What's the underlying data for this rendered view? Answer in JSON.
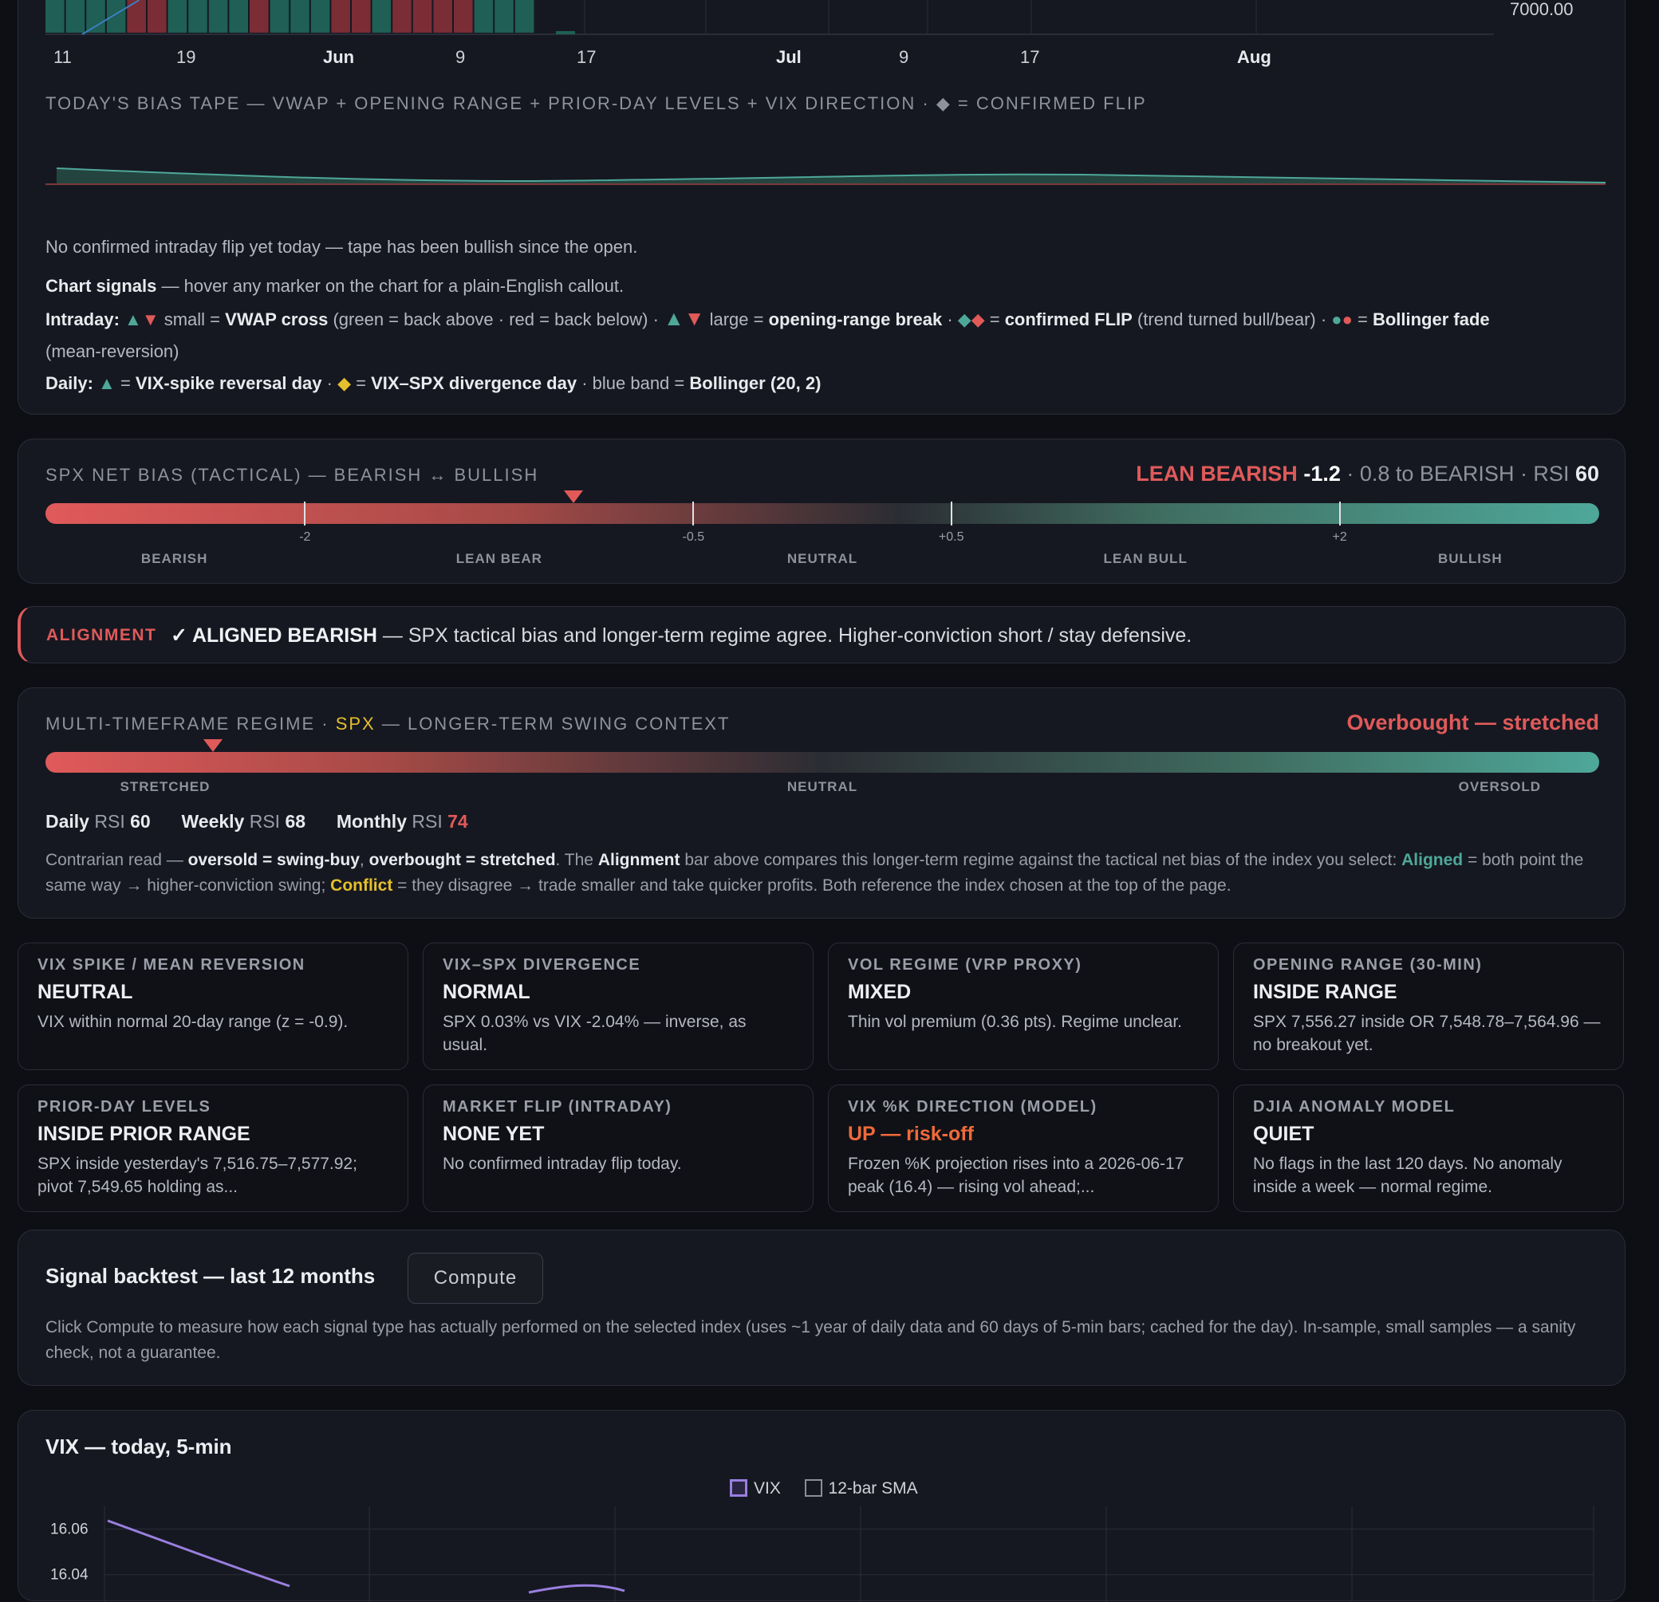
{
  "top_chart": {
    "x_ticks": [
      {
        "label": "11",
        "bold": false
      },
      {
        "label": "19",
        "bold": false
      },
      {
        "label": "Jun",
        "bold": true
      },
      {
        "label": "9",
        "bold": false
      },
      {
        "label": "17",
        "bold": false
      },
      {
        "label": "Jul",
        "bold": true
      },
      {
        "label": "9",
        "bold": false
      },
      {
        "label": "17",
        "bold": false
      },
      {
        "label": "Aug",
        "bold": true
      }
    ],
    "y_label": "7000.00",
    "bar_colors": [
      "#1f5f55",
      "#1f5f55",
      "#1f5f55",
      "#1f5f55",
      "#7a2d35",
      "#7a2d35",
      "#1f5f55",
      "#1f5f55",
      "#1f5f55",
      "#1f5f55",
      "#7a2d35",
      "#1f5f55",
      "#1f5f55",
      "#1f5f55",
      "#7a2d35",
      "#7a2d35",
      "#1f5f55",
      "#7a2d35",
      "#7a2d35",
      "#7a2d35",
      "#7a2d35",
      "#1f5f55",
      "#1f5f55",
      "#1f5f55"
    ]
  },
  "bias_tape": {
    "title": "TODAY'S BIAS TAPE — VWAP + OPENING RANGE + PRIOR-DAY LEVELS + VIX DIRECTION · ◆ = CONFIRMED FLIP",
    "status": "No confirmed intraday flip yet today — tape has been bullish since the open."
  },
  "legend": {
    "chart_signals_label": "Chart signals",
    "chart_signals_text": " — hover any marker on the chart for a plain-English callout.",
    "intraday_label": "Intraday:",
    "intraday_small": " small = ",
    "vwap": "VWAP cross",
    "vwap_desc": " (green = back above · red = back below) · ",
    "large": " large = ",
    "orb": "opening-range break",
    "sep": " · ",
    "eq": " = ",
    "flip": "confirmed FLIP",
    "flip_desc": " (trend turned bull/bear) · ",
    "boll_fade": "Bollinger fade",
    "mean_rev": "(mean-reversion)",
    "daily_label": "Daily:",
    "vix_rev": "VIX-spike reversal day",
    "div_day": "VIX–SPX divergence day",
    "blue_band": " · blue band = ",
    "boll": "Bollinger (20, 2)"
  },
  "net_bias": {
    "title": "SPX NET BIAS (TACTICAL) — BEARISH ↔ BULLISH",
    "label": "LEAN BEARISH",
    "value": "-1.2",
    "distance": " · 0.8 to BEARISH · RSI ",
    "rsi": "60",
    "position": 0.34,
    "zones": [
      "BEARISH",
      "LEAN BEAR",
      "NEUTRAL",
      "LEAN BULL",
      "BULLISH"
    ],
    "ticks": [
      "-2",
      "-0.5",
      "+0.5",
      "+2"
    ]
  },
  "alignment": {
    "label": "ALIGNMENT",
    "status": "✓ ALIGNED BEARISH",
    "text": " — SPX tactical bias and longer-term regime agree. Higher-conviction short / stay defensive."
  },
  "regime": {
    "title_a": "MULTI-TIMEFRAME REGIME · ",
    "index": "SPX",
    "title_b": " — LONGER-TERM SWING CONTEXT",
    "status": "Overbought — stretched",
    "position": 0.108,
    "zones": [
      "STRETCHED",
      "NEUTRAL",
      "OVERSOLD"
    ],
    "daily_label": "Daily",
    "weekly_label": "Weekly",
    "monthly_label": "Monthly",
    "rsi_label": " RSI ",
    "daily_rsi": "60",
    "weekly_rsi": "68",
    "monthly_rsi": "74",
    "desc_1": "Contrarian read — ",
    "desc_os": "oversold = swing-buy",
    "desc_2": ", ",
    "desc_ob": "overbought = stretched",
    "desc_3": ". The ",
    "desc_align": "Alignment",
    "desc_4": " bar above compares this longer-term regime against the tactical net bias of the index you select: ",
    "desc_aligned": "Aligned",
    "desc_5": " = both point the same way → higher-conviction swing; ",
    "desc_conflict": "Conflict",
    "desc_6": " = they disagree → trade smaller and take quicker profits. Both reference the index chosen at the top of the page."
  },
  "tiles": [
    {
      "title": "VIX SPIKE / MEAN REVERSION",
      "status": "NEUTRAL",
      "desc": "VIX within normal 20-day range (z = -0.9).",
      "status_color": "#eceef2"
    },
    {
      "title": "VIX–SPX DIVERGENCE",
      "status": "NORMAL",
      "desc": "SPX 0.03% vs VIX -2.04% — inverse, as usual.",
      "status_color": "#eceef2"
    },
    {
      "title": "VOL REGIME (VRP PROXY)",
      "status": "MIXED",
      "desc": "Thin vol premium (0.36 pts). Regime unclear.",
      "status_color": "#eceef2"
    },
    {
      "title": "OPENING RANGE (30-MIN)",
      "status": "INSIDE RANGE",
      "desc": "SPX 7,556.27 inside OR 7,548.78–7,564.96 — no breakout yet.",
      "status_color": "#eceef2"
    },
    {
      "title": "PRIOR-DAY LEVELS",
      "status": "INSIDE PRIOR RANGE",
      "desc": "SPX inside yesterday's 7,516.75–7,577.92; pivot 7,549.65 holding as...",
      "status_color": "#eceef2"
    },
    {
      "title": "MARKET FLIP (INTRADAY)",
      "status": "NONE YET",
      "desc": "No confirmed intraday flip today.",
      "status_color": "#eceef2"
    },
    {
      "title": "VIX %K DIRECTION (MODEL)",
      "status": "UP — risk-off",
      "desc": "Frozen %K projection rises into a 2026-06-17 peak (16.4) — rising vol ahead;...",
      "status_color": "#f06a3a"
    },
    {
      "title": "DJIA ANOMALY MODEL",
      "status": "QUIET",
      "desc": "No flags in the last 120 days. No anomaly inside a week — normal regime.",
      "status_color": "#eceef2"
    }
  ],
  "backtest": {
    "title": "Signal backtest — last 12 months",
    "button": "Compute",
    "desc": "Click Compute to measure how each signal type has actually performed on the selected index (uses ~1 year of daily data and 60 days of 5-min bars; cached for the day). In-sample, small samples — a sanity check, not a guarantee."
  },
  "vix_chart": {
    "title": "VIX — today, 5-min",
    "legend": [
      "VIX",
      "12-bar SMA"
    ],
    "colors": {
      "vix": "#9a7fe0",
      "sma": "#8a8e98"
    },
    "y_ticks": [
      "16.06",
      "16.04"
    ]
  },
  "chart_data": {
    "type": "line",
    "title": "VIX — today, 5-min",
    "series": [
      {
        "name": "VIX",
        "values": [
          16.06,
          16.04,
          16.02,
          16.03,
          16.04
        ]
      }
    ],
    "y_ticks": [
      16.06,
      16.04
    ]
  }
}
